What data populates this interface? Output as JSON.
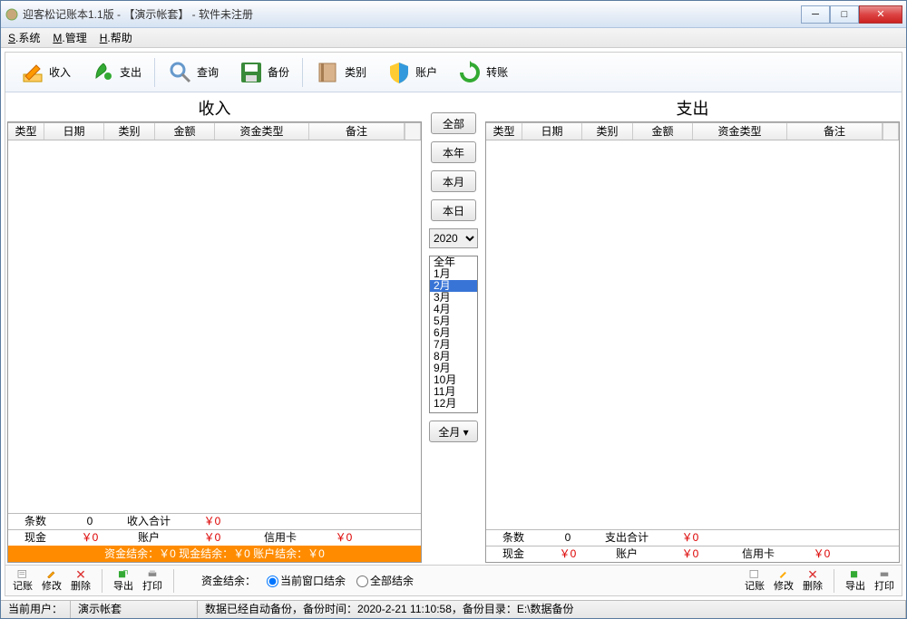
{
  "title": "迎客松记账本1.1版 - 【演示帐套】 - 软件未注册",
  "menu": {
    "sys": "S.系统",
    "mgr": "M.管理",
    "help": "H.帮助"
  },
  "toolbar": {
    "income": "收入",
    "expense": "支出",
    "query": "查询",
    "backup": "备份",
    "category": "类别",
    "account": "账户",
    "transfer": "转账"
  },
  "left": {
    "title": "收入",
    "headers": [
      "类型",
      "日期",
      "类别",
      "金额",
      "资金类型",
      "备注"
    ],
    "row1": {
      "a": "条数",
      "b": "0",
      "c": "收入合计",
      "d": "￥0"
    },
    "row2": {
      "a": "现金",
      "b": "￥0",
      "c": "账户",
      "d": "￥0",
      "e": "信用卡",
      "f": "￥0"
    },
    "orange": "资金结余：￥0 现金结余：￥0 账户结余：￥0"
  },
  "right": {
    "title": "支出",
    "headers": [
      "类型",
      "日期",
      "类别",
      "金额",
      "资金类型",
      "备注"
    ],
    "row1": {
      "a": "条数",
      "b": "0",
      "c": "支出合计",
      "d": "￥0"
    },
    "row2": {
      "a": "现金",
      "b": "￥0",
      "c": "账户",
      "d": "￥0",
      "e": "信用卡",
      "f": "￥0"
    }
  },
  "mid": {
    "all": "全部",
    "year": "本年",
    "month": "本月",
    "day": "本日",
    "yearSel": "2020",
    "months": [
      "全年",
      "1月",
      "2月",
      "3月",
      "4月",
      "5月",
      "6月",
      "7月",
      "8月",
      "9月",
      "10月",
      "11月",
      "12月"
    ],
    "selected": 2,
    "allmonth": "全月"
  },
  "bottom": {
    "b1": "记账",
    "b2": "修改",
    "b3": "删除",
    "b4": "导出",
    "b5": "打印",
    "balance": "资金结余：",
    "r1": "当前窗口结余",
    "r2": "全部结余"
  },
  "status": {
    "user_label": "当前用户：",
    "user": "演示帐套",
    "backup": "数据已经自动备份，备份时间：2020-2-21 11:10:58，备份目录：E:\\数据备份"
  }
}
